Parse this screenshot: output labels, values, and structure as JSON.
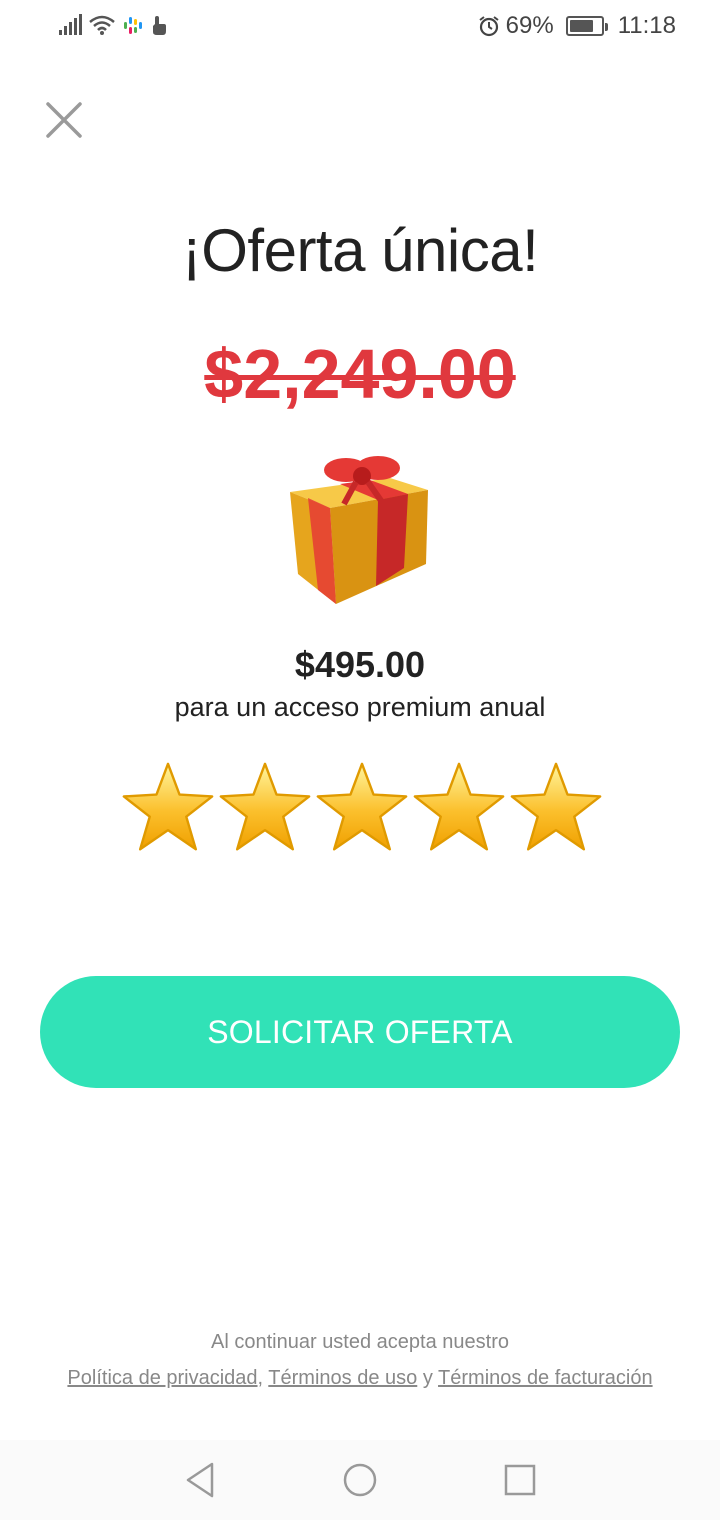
{
  "status_bar": {
    "battery_percent": "69%",
    "battery_level": 0.69,
    "time": "11:18",
    "icons": [
      "signal-icon",
      "wifi-icon",
      "notification-app-icon",
      "touch-icon",
      "alarm-icon",
      "battery-icon"
    ]
  },
  "offer": {
    "title": "¡Oferta única!",
    "old_price": "$2,249.00",
    "new_price": "$495.00",
    "subtitle": "para un acceso premium anual",
    "rating_stars": 5
  },
  "cta": {
    "label": "SOLICITAR OFERTA",
    "color": "#31e2b7"
  },
  "legal": {
    "intro": "Al continuar usted acepta nuestro",
    "privacy": "Política de privacidad",
    "separator1": ",",
    "terms": "Términos de uso",
    "separator2": "y",
    "billing": "Términos de facturación"
  },
  "colors": {
    "old_price": "#e0383e",
    "text": "#222222",
    "muted": "#888888"
  }
}
